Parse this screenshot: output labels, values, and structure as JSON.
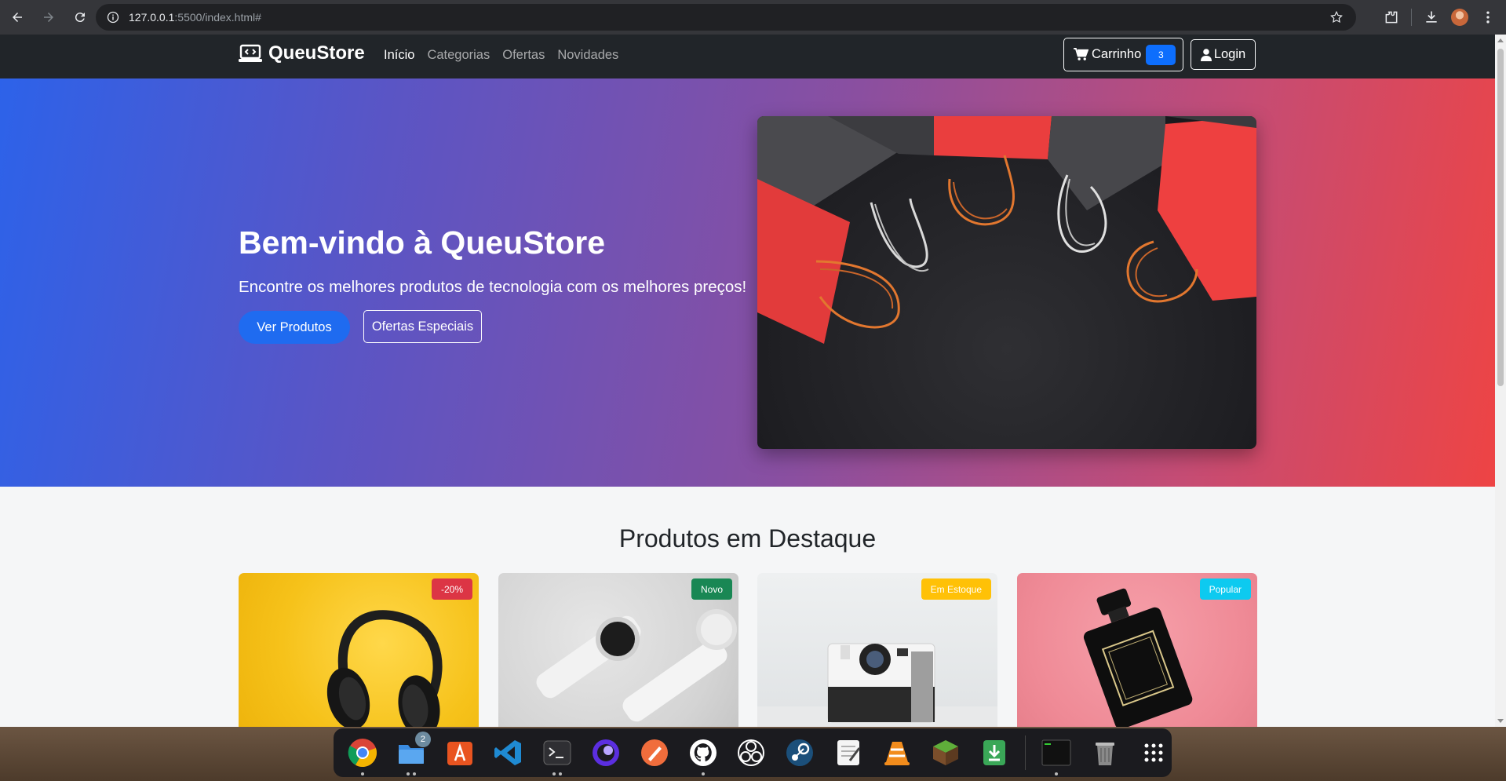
{
  "browser": {
    "url_host": "127.0.0.1",
    "url_rest": ":5500/index.html#"
  },
  "navbar": {
    "brand": "QueuStore",
    "links": [
      "Início",
      "Categorias",
      "Ofertas",
      "Novidades"
    ],
    "cart_label": "Carrinho",
    "cart_count": "3",
    "login_label": "Login"
  },
  "hero": {
    "title": "Bem-vindo à QueuStore",
    "subtitle": "Encontre os melhores produtos de tecnologia com os melhores preços!",
    "primary_button": "Ver Produtos",
    "secondary_button": "Ofertas Especiais"
  },
  "products": {
    "title": "Produtos em Destaque",
    "cards": [
      {
        "badge": "-20%",
        "badge_color": "#dc3545"
      },
      {
        "badge": "Novo",
        "badge_color": "#198754"
      },
      {
        "badge": "Em Estoque",
        "badge_color": "#ffc107"
      },
      {
        "badge": "Popular",
        "badge_color": "#0dcaf0"
      }
    ]
  },
  "dock": {
    "finder_badge": "2",
    "apps": [
      "chrome-icon",
      "files-icon",
      "app-center-icon",
      "vscode-icon",
      "terminal-icon",
      "browser-icon",
      "pen-icon",
      "github-icon",
      "obs-icon",
      "steam-icon",
      "text-editor-icon",
      "vlc-icon",
      "minecraft-icon",
      "installer-icon",
      "terminal-exec-icon",
      "trash-icon",
      "app-grid-icon"
    ]
  }
}
